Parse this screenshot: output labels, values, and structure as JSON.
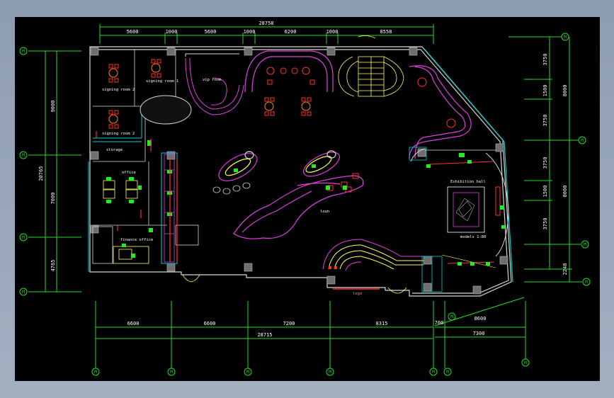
{
  "drawing": {
    "top_dims": {
      "total": "28758",
      "parts": [
        "5600",
        "1000",
        "5600",
        "1000",
        "6200",
        "1000",
        "8558"
      ]
    },
    "bottom_dims": {
      "parts": [
        "6600",
        "6600",
        "7200",
        "8315"
      ],
      "total": "28715",
      "right_parts": [
        "700",
        "8600"
      ],
      "right_total": "7300"
    },
    "left_dims": {
      "total": "20765",
      "parts": [
        "9000",
        "7000",
        "4765"
      ]
    },
    "right_dims": {
      "inner": [
        "3750",
        "1500",
        "3750",
        "3750",
        "1500",
        "3750"
      ],
      "outer": [
        "8000",
        "8000"
      ],
      "tail": "2248"
    },
    "axis_marker": "M",
    "rooms": {
      "signing_room_2": "signing room 2",
      "signing_room_1": "signing room 1",
      "signing_room_3": "signing room 2",
      "vip_room": "vip room",
      "storage": "storage",
      "office": "office",
      "finance_office": "finance office",
      "lounge": "loun",
      "exhibition_hall": "Exhibition hall",
      "models": "models 1:80",
      "logo": "logo"
    },
    "colors": {
      "wall": "#d6d6d6",
      "dimension": "#22dd22",
      "magenta": "#e040e0",
      "yellow": "#ffff55",
      "red": "#ff3030",
      "cyan": "#00d0d0",
      "orange": "#ff8800",
      "green": "#22ee22"
    }
  }
}
